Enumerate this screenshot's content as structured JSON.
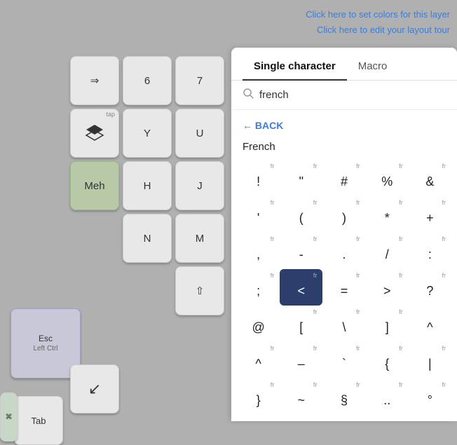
{
  "topLinks": {
    "colors": "Click here to set colors for this layer",
    "tour": "Click here to edit your layout tour"
  },
  "keys": {
    "arrow": "⇒",
    "six": "6",
    "seven": "7",
    "tapLabel": "tap",
    "layers": "⊕",
    "y": "Y",
    "u": "U",
    "meh": "Meh",
    "h": "H",
    "j": "J",
    "n": "N",
    "m": "M",
    "shift": "⇧",
    "esc": "Esc\nLeft Ctrl",
    "fn": "↙",
    "tab": "Tab"
  },
  "panel": {
    "tabs": [
      {
        "label": "Single character",
        "active": true
      },
      {
        "label": "Macro",
        "active": false
      }
    ],
    "searchPlaceholder": "french",
    "backLabel": "← BACK",
    "sectionTitle": "French",
    "characters": [
      {
        "char": "!",
        "tag": "fr",
        "active": false
      },
      {
        "char": "\"",
        "tag": "fr",
        "active": false
      },
      {
        "char": "#",
        "tag": "fr",
        "active": false
      },
      {
        "char": "%",
        "tag": "fr",
        "active": false
      },
      {
        "char": "&",
        "tag": "fr",
        "active": false
      },
      {
        "char": "'",
        "tag": "fr",
        "active": false
      },
      {
        "char": "(",
        "tag": "fr",
        "active": false
      },
      {
        "char": ")",
        "tag": "fr",
        "active": false
      },
      {
        "char": "*",
        "tag": "fr",
        "active": false
      },
      {
        "char": "+",
        "tag": "fr",
        "active": false
      },
      {
        "char": ",",
        "tag": "fr",
        "active": false
      },
      {
        "char": "-",
        "tag": "fr",
        "active": false
      },
      {
        "char": ".",
        "tag": "fr",
        "active": false
      },
      {
        "char": "/",
        "tag": "fr",
        "active": false
      },
      {
        "char": ":",
        "tag": "fr",
        "active": false
      },
      {
        "char": ";",
        "tag": "fr",
        "active": false
      },
      {
        "char": "<",
        "tag": "fr",
        "active": true
      },
      {
        "char": "=",
        "tag": "fr",
        "active": false
      },
      {
        "char": ">",
        "tag": "fr",
        "active": false
      },
      {
        "char": "?",
        "tag": "fr",
        "active": false
      },
      {
        "char": "@",
        "tag": "",
        "active": false
      },
      {
        "char": "[",
        "tag": "fr",
        "active": false
      },
      {
        "char": "\\",
        "tag": "fr",
        "active": false
      },
      {
        "char": "]",
        "tag": "fr",
        "active": false
      },
      {
        "char": "^",
        "tag": "",
        "active": false
      },
      {
        "char": "^",
        "tag": "fr",
        "active": false
      },
      {
        "char": "–",
        "tag": "fr",
        "active": false
      },
      {
        "char": "`",
        "tag": "fr",
        "active": false
      },
      {
        "char": "{",
        "tag": "fr",
        "active": false
      },
      {
        "char": "|",
        "tag": "fr",
        "active": false
      },
      {
        "char": "}",
        "tag": "fr",
        "active": false
      },
      {
        "char": "~",
        "tag": "fr",
        "active": false
      },
      {
        "char": "§",
        "tag": "fr",
        "active": false
      },
      {
        "char": "..",
        "tag": "fr",
        "active": false
      },
      {
        "char": "°",
        "tag": "fr",
        "active": false
      }
    ]
  }
}
